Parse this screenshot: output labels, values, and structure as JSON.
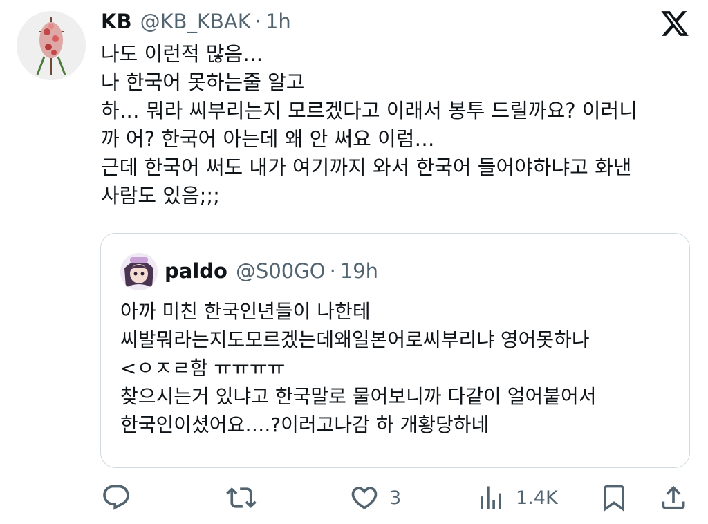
{
  "tweet": {
    "name": "KB",
    "handle": "@KB_KBAK",
    "separator": "·",
    "time": "1h",
    "text": "나도 이런적 많음…\n나 한국어 못하는줄 알고\n하… 뭐라 씨부리는지 모르겠다고 이래서 봉투 드릴까요? 이러니\n까 어? 한국어 아는데 왜 안 써요 이럼…\n근데 한국어 써도 내가 여기까지 와서 한국어 들어야하냐고 화낸\n사람도 있음;;;"
  },
  "quoted_tweet": {
    "name": "paldo",
    "handle": "@S00GO",
    "separator": "·",
    "time": "19h",
    "text": "아까 미친 한국인년들이 나한테\n씨발뭐라는지도모르겠는데왜일본어로씨부리냐 영어못하나\n<ㅇㅈㄹ함 ㅠㅠㅠㅠ\n찾으시는거 있냐고 한국말로 물어보니까  다같이 얼어붙어서\n한국인이셨어요….?이러고나감 하 개황당하네"
  },
  "actions": {
    "reply_icon": "reply-icon",
    "retweet_icon": "retweet-icon",
    "like_icon": "heart-icon",
    "like_count": "3",
    "views_icon": "views-icon",
    "views_count": "1.4K",
    "bookmark_icon": "bookmark-icon",
    "share_icon": "share-icon"
  },
  "colors": {
    "text": "#0f1419",
    "secondary": "#536471",
    "border": "#cfd9de"
  }
}
